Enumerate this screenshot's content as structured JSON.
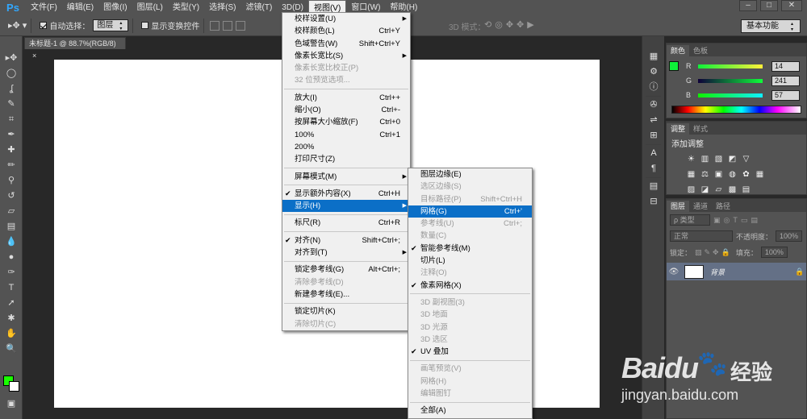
{
  "app": {
    "logo": "Ps"
  },
  "menubar": {
    "items": [
      "文件(F)",
      "编辑(E)",
      "图像(I)",
      "图层(L)",
      "类型(Y)",
      "选择(S)",
      "滤镜(T)",
      "3D(D)",
      "视图(V)",
      "窗口(W)",
      "帮助(H)"
    ],
    "active_index": 8
  },
  "window_controls": [
    "–",
    "□",
    "✕"
  ],
  "options_bar": {
    "auto_select_label": "自动选择：",
    "auto_select_checked": true,
    "auto_select_target": "图层",
    "show_transform_label": "显示变换控件",
    "show_transform_checked": false,
    "mode_3d_label": "3D 模式："
  },
  "workspace": {
    "selected": "基本功能"
  },
  "document": {
    "tab_title": "未标题-1 @ 88.7%(RGB/8)",
    "close_glyph": "×"
  },
  "tools": [
    {
      "name": "move-tool-icon",
      "glyph": "▸✥"
    },
    {
      "name": "marquee-tool-icon",
      "glyph": "◯"
    },
    {
      "name": "lasso-tool-icon",
      "glyph": "ʆ"
    },
    {
      "name": "quick-select-tool-icon",
      "glyph": "✎"
    },
    {
      "name": "crop-tool-icon",
      "glyph": "⌗"
    },
    {
      "name": "eyedropper-tool-icon",
      "glyph": "✒"
    },
    {
      "name": "healing-brush-tool-icon",
      "glyph": "✚"
    },
    {
      "name": "brush-tool-icon",
      "glyph": "✏"
    },
    {
      "name": "clone-stamp-tool-icon",
      "glyph": "⚲"
    },
    {
      "name": "history-brush-tool-icon",
      "glyph": "↺"
    },
    {
      "name": "eraser-tool-icon",
      "glyph": "▱"
    },
    {
      "name": "gradient-tool-icon",
      "glyph": "▤"
    },
    {
      "name": "blur-tool-icon",
      "glyph": "💧"
    },
    {
      "name": "dodge-tool-icon",
      "glyph": "●"
    },
    {
      "name": "pen-tool-icon",
      "glyph": "✑"
    },
    {
      "name": "type-tool-icon",
      "glyph": "T"
    },
    {
      "name": "path-select-tool-icon",
      "glyph": "➚"
    },
    {
      "name": "shape-tool-icon",
      "glyph": "✱"
    },
    {
      "name": "hand-tool-icon",
      "glyph": "✋"
    },
    {
      "name": "zoom-tool-icon",
      "glyph": "🔍"
    }
  ],
  "icon_strip": [
    {
      "name": "history-panel-icon",
      "glyph": "▦"
    },
    {
      "name": "properties-panel-icon",
      "glyph": "⚙"
    },
    {
      "name": "info-panel-icon",
      "glyph": "ⓘ"
    },
    {
      "name": "brush-panel-icon",
      "glyph": "✇"
    },
    {
      "name": "brush-presets-icon",
      "glyph": "⇌"
    },
    {
      "name": "clone-source-icon",
      "glyph": "⊞"
    },
    {
      "name": "character-panel-icon",
      "glyph": "A"
    },
    {
      "name": "paragraph-panel-icon",
      "glyph": "¶"
    },
    {
      "name": "notes-panel-icon",
      "glyph": "▤"
    },
    {
      "name": "layer-comps-icon",
      "glyph": "⊟"
    }
  ],
  "color_panel": {
    "tabs": [
      "颜色",
      "色板"
    ],
    "channels": [
      {
        "label": "R",
        "value": "14"
      },
      {
        "label": "G",
        "value": "241"
      },
      {
        "label": "B",
        "value": "57"
      }
    ],
    "foreground": "#0ef139"
  },
  "adjust_panel": {
    "tabs": [
      "调整",
      "样式"
    ],
    "title": "添加调整",
    "row1": [
      "☀",
      "▥",
      "▧",
      "◩",
      "▽"
    ],
    "row2": [
      "▦",
      "⚖",
      "▣",
      "◍",
      "✿",
      "▦"
    ],
    "row3": [
      "▨",
      "◪",
      "▱",
      "▩",
      "▤"
    ]
  },
  "layers_panel": {
    "tabs": [
      "图层",
      "通道",
      "路径"
    ],
    "filter_label": "ρ 类型",
    "blend_mode": "正常",
    "opacity_label": "不透明度：",
    "opacity_value": "100%",
    "lock_label": "锁定：",
    "fill_label": "填充：",
    "fill_value": "100%",
    "layer": {
      "name": "背景",
      "eye": "👁",
      "lock": "🔒"
    }
  },
  "view_menu": [
    {
      "label": "校样设置(U)",
      "arrow": true
    },
    {
      "label": "校样颜色(L)",
      "shortcut": "Ctrl+Y"
    },
    {
      "label": "色域警告(W)",
      "shortcut": "Shift+Ctrl+Y"
    },
    {
      "label": "像素长宽比(S)",
      "arrow": true
    },
    {
      "label": "像素长宽比校正(P)",
      "disabled": true
    },
    {
      "label": "32 位预览选项...",
      "disabled": true
    },
    {
      "sep": true
    },
    {
      "label": "放大(I)",
      "shortcut": "Ctrl++"
    },
    {
      "label": "缩小(O)",
      "shortcut": "Ctrl+-"
    },
    {
      "label": "按屏幕大小缩放(F)",
      "shortcut": "Ctrl+0"
    },
    {
      "label": "100%",
      "shortcut": "Ctrl+1"
    },
    {
      "label": "200%"
    },
    {
      "label": "打印尺寸(Z)"
    },
    {
      "sep": true
    },
    {
      "label": "屏幕模式(M)",
      "arrow": true
    },
    {
      "sep": true
    },
    {
      "label": "显示额外内容(X)",
      "shortcut": "Ctrl+H",
      "checked": true
    },
    {
      "label": "显示(H)",
      "arrow": true,
      "highlighted": true
    },
    {
      "sep": true
    },
    {
      "label": "标尺(R)",
      "shortcut": "Ctrl+R"
    },
    {
      "sep": true
    },
    {
      "label": "对齐(N)",
      "shortcut": "Shift+Ctrl+;",
      "checked": true
    },
    {
      "label": "对齐到(T)",
      "arrow": true
    },
    {
      "sep": true
    },
    {
      "label": "锁定参考线(G)",
      "shortcut": "Alt+Ctrl+;"
    },
    {
      "label": "清除参考线(D)",
      "disabled": true
    },
    {
      "label": "新建参考线(E)..."
    },
    {
      "sep": true
    },
    {
      "label": "锁定切片(K)"
    },
    {
      "label": "清除切片(C)",
      "disabled": true
    }
  ],
  "show_submenu": [
    {
      "label": "图层边缘(E)"
    },
    {
      "label": "选区边缘(S)",
      "disabled": true
    },
    {
      "label": "目标路径(P)",
      "shortcut": "Shift+Ctrl+H",
      "disabled": true
    },
    {
      "label": "网格(G)",
      "shortcut": "Ctrl+'",
      "highlighted": true
    },
    {
      "label": "参考线(U)",
      "shortcut": "Ctrl+;",
      "disabled": true
    },
    {
      "label": "数量(C)",
      "disabled": true
    },
    {
      "label": "智能参考线(M)",
      "checked": true
    },
    {
      "label": "切片(L)"
    },
    {
      "label": "注释(O)",
      "disabled": true
    },
    {
      "label": "像素网格(X)",
      "checked": true
    },
    {
      "sep": true
    },
    {
      "label": "3D 副视图(3)",
      "disabled": true
    },
    {
      "label": "3D 地面",
      "disabled": true
    },
    {
      "label": "3D 光源",
      "disabled": true
    },
    {
      "label": "3D 选区",
      "disabled": true
    },
    {
      "label": "UV 叠加",
      "checked": true
    },
    {
      "sep": true
    },
    {
      "label": "画笔预览(V)",
      "disabled": true
    },
    {
      "label": "网格(H)",
      "disabled": true
    },
    {
      "label": "编辑图钉",
      "disabled": true
    },
    {
      "sep": true
    },
    {
      "label": "全部(A)"
    }
  ],
  "watermark": {
    "brand": "Baidu",
    "paw": "🐾",
    "cn": "经验",
    "url": "jingyan.baidu.com"
  }
}
